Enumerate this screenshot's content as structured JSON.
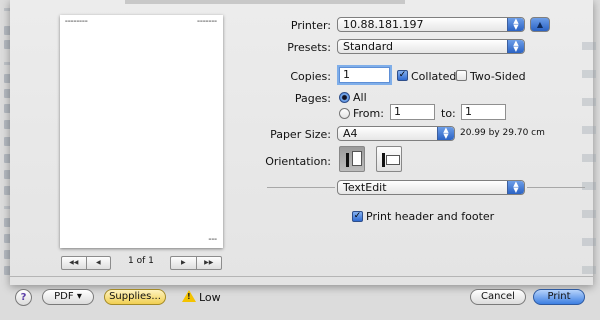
{
  "printer": {
    "label": "Printer:",
    "value": "10.88.181.197"
  },
  "presets": {
    "label": "Presets:",
    "value": "Standard"
  },
  "copies": {
    "label": "Copies:",
    "value": "1",
    "collated_label": "Collated",
    "collated": true,
    "two_sided_label": "Two-Sided",
    "two_sided": false
  },
  "pages": {
    "label": "Pages:",
    "all_label": "All",
    "from_label": "From:",
    "from_value": "1",
    "to_label": "to:",
    "to_value": "1",
    "selected": "All"
  },
  "paper_size": {
    "label": "Paper Size:",
    "value": "A4",
    "dimensions": "20.99 by 29.70 cm"
  },
  "orientation": {
    "label": "Orientation:",
    "selected": "portrait"
  },
  "app_panel": {
    "value": "TextEdit"
  },
  "print_header_footer": {
    "label": "Print header and footer",
    "checked": true
  },
  "preview": {
    "page_indicator": "1 of 1",
    "nav_first": "◀◀",
    "nav_prev": "◀",
    "nav_next": "▶",
    "nav_last": "▶▶"
  },
  "buttons": {
    "help": "?",
    "pdf": "PDF ▾",
    "supplies": "Supplies...",
    "supply_status": "Low",
    "cancel": "Cancel",
    "print": "Print"
  },
  "icons": {
    "disclosure": "disclosure-up-icon",
    "warning": "warning-icon",
    "help": "help-icon"
  }
}
